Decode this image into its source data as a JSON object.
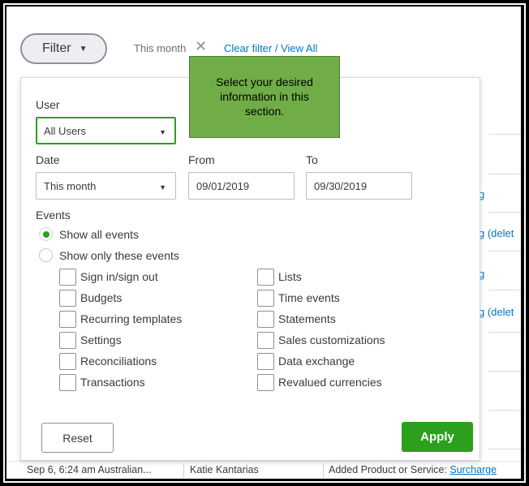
{
  "filter_bar": {
    "filter_label": "Filter",
    "chip_text": "This month",
    "clear_link": "Clear filter / View All"
  },
  "panel": {
    "user_label": "User",
    "user_value": "All Users",
    "date_label": "Date",
    "date_value": "This month",
    "from_label": "From",
    "from_value": "09/01/2019",
    "to_label": "To",
    "to_value": "09/30/2019",
    "events_label": "Events",
    "radio_all": "Show all events",
    "radio_only": "Show only these events",
    "checkboxes_left": [
      "Sign in/sign out",
      "Budgets",
      "Recurring templates",
      "Settings",
      "Reconciliations",
      "Transactions"
    ],
    "checkboxes_right": [
      "Lists",
      "Time events",
      "Statements",
      "Sales customizations",
      "Data exchange",
      "Revalued currencies"
    ],
    "reset_label": "Reset",
    "apply_label": "Apply"
  },
  "callout": {
    "line1": "Select your desired",
    "line2": "information in this",
    "line3": "section."
  },
  "background": {
    "link_fragment_1": "g",
    "link_fragment_2": "g (delet",
    "link_fragment_3": "g",
    "link_fragment_4": "g (delet",
    "row_date": "Sep 6, 6:24 am Australian...",
    "row_user": "Katie Kantarias",
    "row_event_prefix": "Added Product or Service: ",
    "row_event_link": "Surcharge"
  },
  "colors": {
    "accent_green": "#2ca01c",
    "link_blue": "#0077c5",
    "callout_green": "#70ad47"
  }
}
